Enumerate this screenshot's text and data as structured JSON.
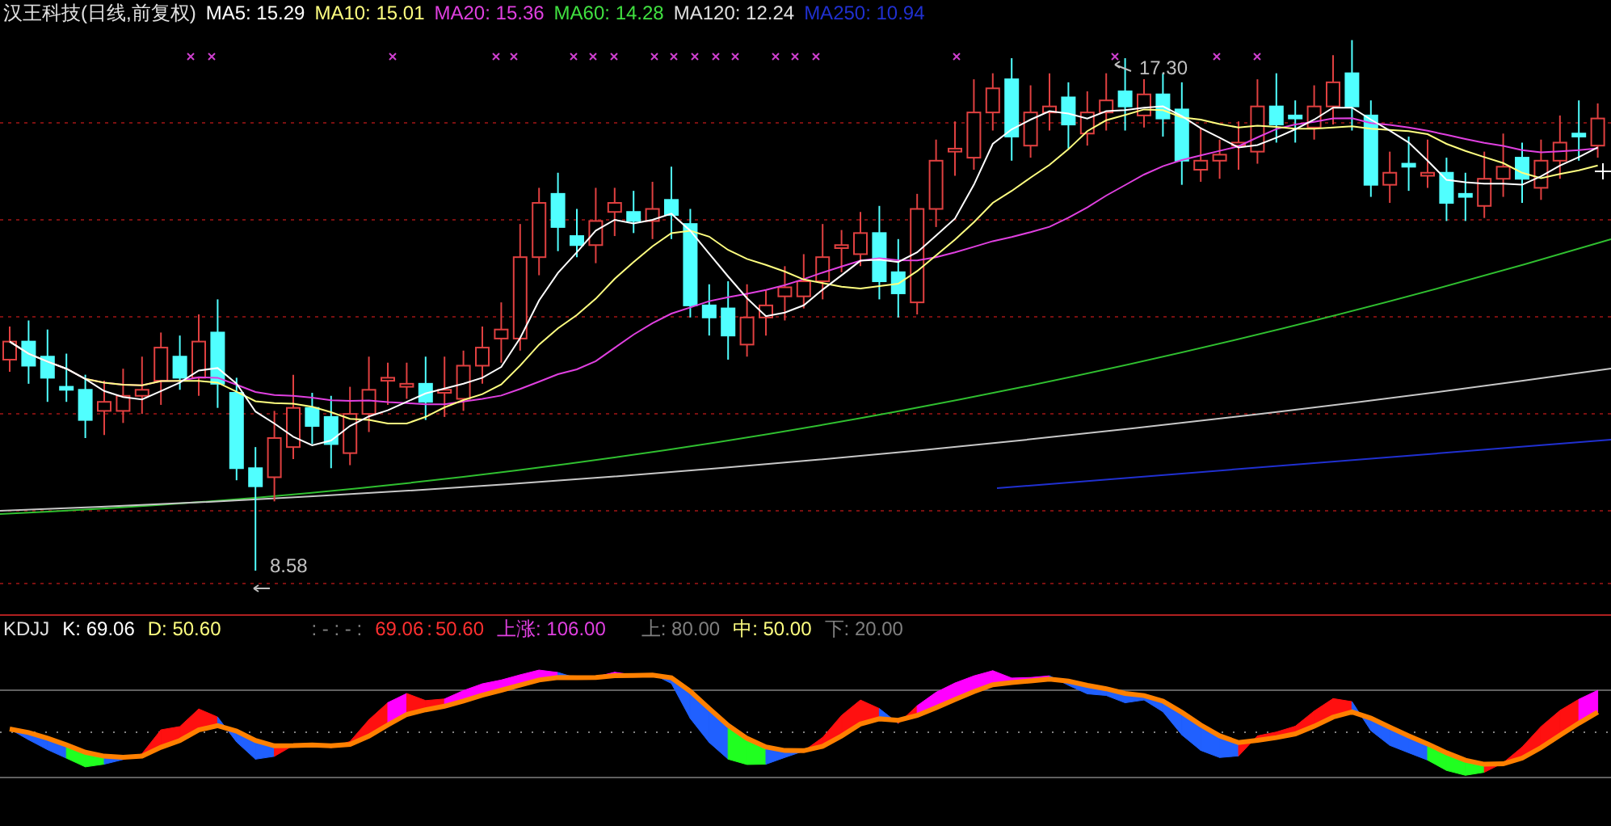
{
  "header": {
    "title": "汉王科技(日线,前复权)",
    "moving_averages": [
      {
        "label": "MA5:",
        "value": "15.29",
        "color": "#ffffff"
      },
      {
        "label": "MA10:",
        "value": "15.01",
        "color": "#ffff80"
      },
      {
        "label": "MA20:",
        "value": "15.36",
        "color": "#e040e0"
      },
      {
        "label": "MA60:",
        "value": "14.28",
        "color": "#40e040"
      },
      {
        "label": "MA120:",
        "value": "12.24",
        "color": "#e0e0e0"
      },
      {
        "label": "MA250:",
        "value": "10.94",
        "color": "#2030d0"
      }
    ]
  },
  "price_labels": [
    {
      "kind": "high",
      "text": "17.30"
    },
    {
      "kind": "low",
      "text": "8.58"
    }
  ],
  "indicator": {
    "name": "KDJJ",
    "values": [
      {
        "label": "K:",
        "value": "69.06",
        "color": "#ffffff"
      },
      {
        "label": "D:",
        "value": "50.60",
        "color": "#ffff80"
      }
    ],
    "separator": ": - : - :",
    "readings": [
      {
        "text": "69.06",
        "color": "#ff3030"
      },
      {
        "text": ": ",
        "color": "#ff3030"
      },
      {
        "text": "50.60",
        "color": "#ff3030"
      }
    ],
    "rise": {
      "label": "上涨:",
      "value": "106.00"
    },
    "levels": [
      {
        "label": "上:",
        "value": "80.00",
        "color": "#808080"
      },
      {
        "label": "中:",
        "value": "50.00",
        "color": "#ffff80"
      },
      {
        "label": "下:",
        "value": "20.00",
        "color": "#808080"
      }
    ]
  }
}
